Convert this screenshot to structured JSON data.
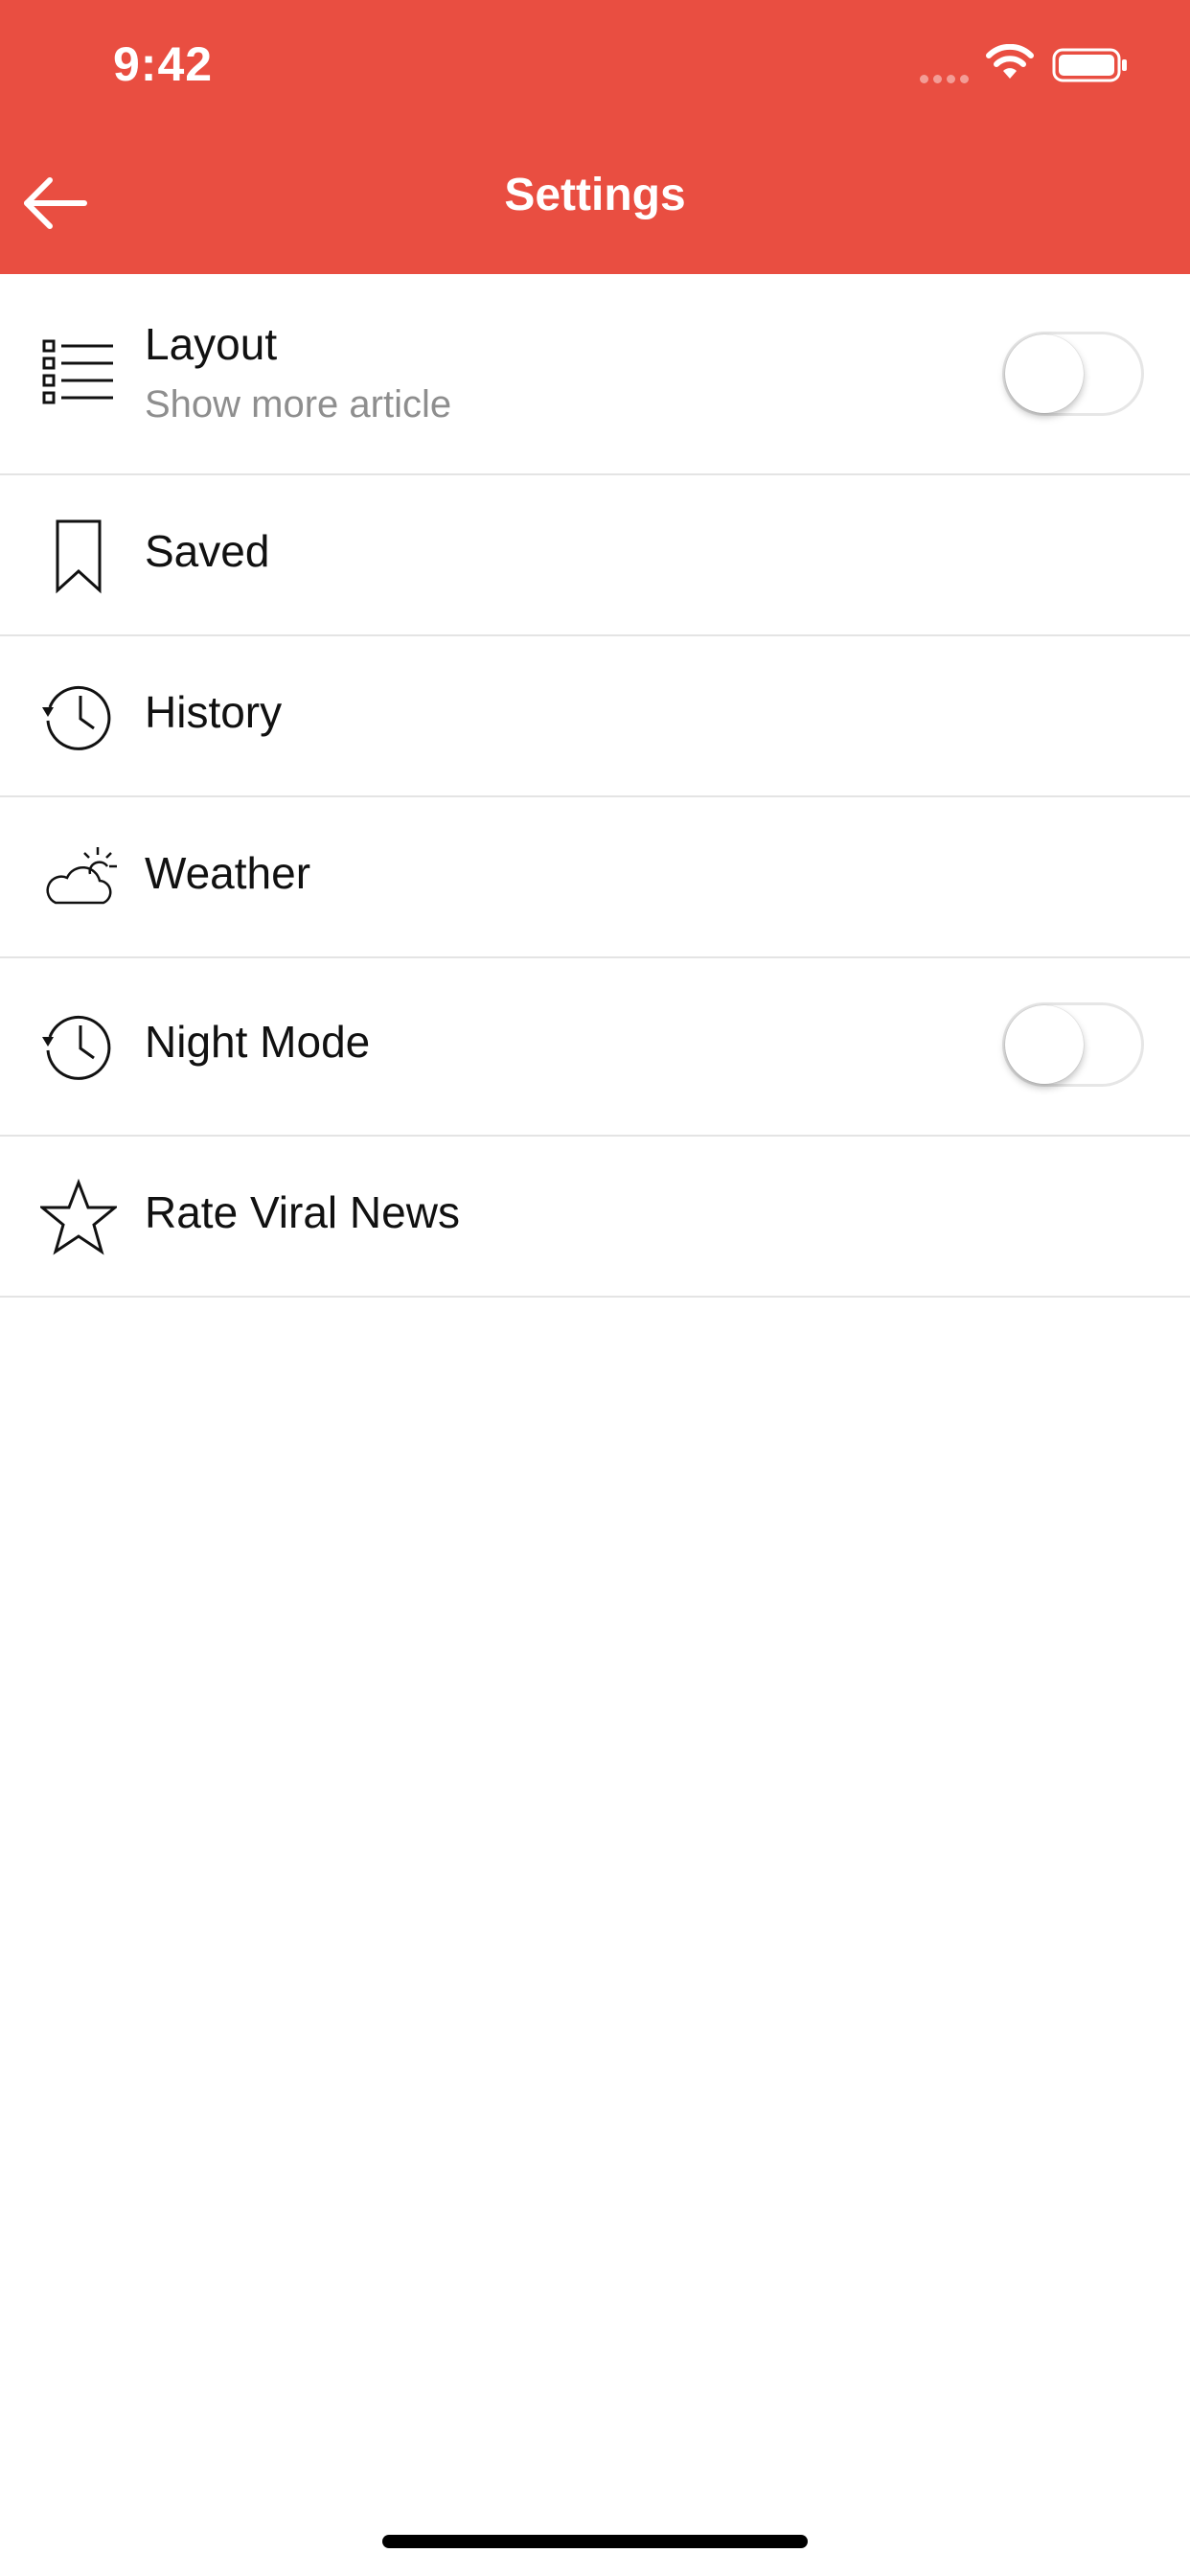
{
  "status_bar": {
    "time": "9:42"
  },
  "header": {
    "title": "Settings",
    "back_icon": "arrow-left-icon"
  },
  "settings": [
    {
      "label": "Layout",
      "subtitle": "Show more article",
      "icon": "list-icon",
      "toggle": false
    },
    {
      "label": "Saved",
      "icon": "bookmark-icon"
    },
    {
      "label": "History",
      "icon": "history-icon"
    },
    {
      "label": "Weather",
      "icon": "cloud-sun-icon"
    },
    {
      "label": "Night Mode",
      "icon": "history-icon",
      "toggle": false
    },
    {
      "label": "Rate Viral News",
      "icon": "star-icon"
    }
  ],
  "colors": {
    "header_bg": "#e94e41",
    "divider": "#e4e4e4",
    "subtitle": "#8e8e8e"
  }
}
